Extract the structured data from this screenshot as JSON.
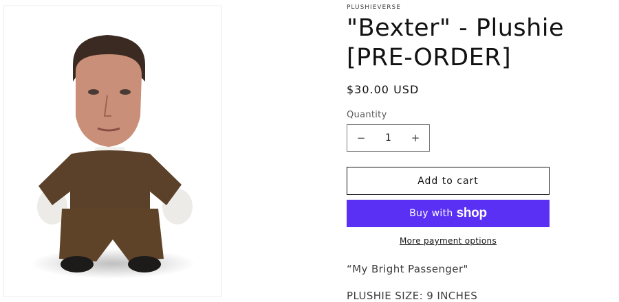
{
  "product": {
    "vendor": "PLUSHIEVERSE",
    "title": "\"Bexter\" - Plushie [PRE-ORDER]",
    "price": "$30.00 USD",
    "quantity_label": "Quantity",
    "quantity_value": "1",
    "minus_symbol": "−",
    "plus_symbol": "+",
    "add_to_cart_label": "Add to cart",
    "buy_with_label": "Buy with",
    "buy_with_brand": "shop",
    "more_payment_label": "More payment options",
    "description_quote": "“My Bright Passenger\"",
    "description_size": "PLUSHIE SIZE: 9 INCHES"
  },
  "colors": {
    "shop_button": "#5a31f4",
    "text": "#121212",
    "border": "#7a7a7a"
  },
  "icons": {
    "product_image": "plush-doll-image",
    "minus": "minus-icon",
    "plus": "plus-icon"
  }
}
